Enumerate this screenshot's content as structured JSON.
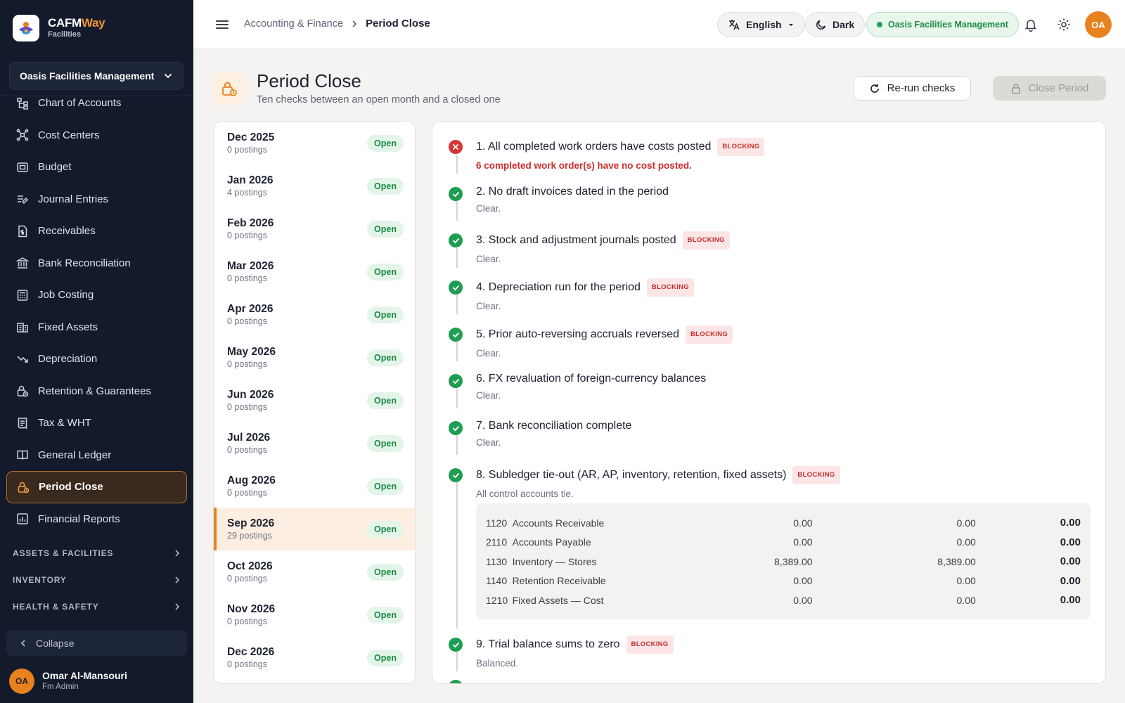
{
  "brand": {
    "name_main": "CAFM",
    "name_accent": "Way",
    "sub": "Facilities"
  },
  "org_select": {
    "value": "Oasis Facilities Management"
  },
  "sidebar": {
    "items": [
      {
        "label": "Chart of Accounts",
        "icon": "hierarchy-icon",
        "active": false
      },
      {
        "label": "Cost Centers",
        "icon": "network-icon",
        "active": false
      },
      {
        "label": "Budget",
        "icon": "wallet-icon",
        "active": false
      },
      {
        "label": "Journal Entries",
        "icon": "edit-lines-icon",
        "active": false
      },
      {
        "label": "Receivables",
        "icon": "dollar-doc-icon",
        "active": false
      },
      {
        "label": "Bank Reconciliation",
        "icon": "bank-icon",
        "active": false
      },
      {
        "label": "Job Costing",
        "icon": "calculator-icon",
        "active": false
      },
      {
        "label": "Fixed Assets",
        "icon": "building-icon",
        "active": false
      },
      {
        "label": "Depreciation",
        "icon": "trend-down-icon",
        "active": false
      },
      {
        "label": "Retention & Guarantees",
        "icon": "lock-clock-icon",
        "active": false
      },
      {
        "label": "Tax & WHT",
        "icon": "receipt-icon",
        "active": false
      },
      {
        "label": "General Ledger",
        "icon": "book-icon",
        "active": false
      },
      {
        "label": "Period Close",
        "icon": "lock-clock-icon",
        "active": true
      },
      {
        "label": "Financial Reports",
        "icon": "bar-chart-icon",
        "active": false
      }
    ],
    "sections": [
      "ASSETS & FACILITIES",
      "INVENTORY",
      "HEALTH & SAFETY"
    ],
    "collapse_label": "Collapse",
    "user": {
      "initials": "OA",
      "name": "Omar Al-Mansouri",
      "role": "Fm Admin"
    }
  },
  "topbar": {
    "breadcrumb": [
      "Accounting & Finance",
      "Period Close"
    ],
    "language": "English",
    "theme": "Dark",
    "org_badge": "Oasis Facilities Management",
    "avatar_initials": "OA"
  },
  "page": {
    "title": "Period Close",
    "subtitle": "Ten checks between an open month and a closed one",
    "rerun_label": "Re-run checks",
    "close_label": "Close Period"
  },
  "periods": [
    {
      "name": "Dec 2025",
      "count": "0 postings",
      "status": "Open",
      "selected": false
    },
    {
      "name": "Jan 2026",
      "count": "4 postings",
      "status": "Open",
      "selected": false
    },
    {
      "name": "Feb 2026",
      "count": "0 postings",
      "status": "Open",
      "selected": false
    },
    {
      "name": "Mar 2026",
      "count": "0 postings",
      "status": "Open",
      "selected": false
    },
    {
      "name": "Apr 2026",
      "count": "0 postings",
      "status": "Open",
      "selected": false
    },
    {
      "name": "May 2026",
      "count": "0 postings",
      "status": "Open",
      "selected": false
    },
    {
      "name": "Jun 2026",
      "count": "0 postings",
      "status": "Open",
      "selected": false
    },
    {
      "name": "Jul 2026",
      "count": "0 postings",
      "status": "Open",
      "selected": false
    },
    {
      "name": "Aug 2026",
      "count": "0 postings",
      "status": "Open",
      "selected": false
    },
    {
      "name": "Sep 2026",
      "count": "29 postings",
      "status": "Open",
      "selected": true
    },
    {
      "name": "Oct 2026",
      "count": "0 postings",
      "status": "Open",
      "selected": false
    },
    {
      "name": "Nov 2026",
      "count": "0 postings",
      "status": "Open",
      "selected": false
    },
    {
      "name": "Dec 2026",
      "count": "0 postings",
      "status": "Open",
      "selected": false
    }
  ],
  "blocking_label": "BLOCKING",
  "checks": [
    {
      "title": "1. All completed work orders have costs posted",
      "blocking": true,
      "status": "fail",
      "note": "6 completed work order(s) have no cost posted."
    },
    {
      "title": "2. No draft invoices dated in the period",
      "blocking": false,
      "status": "ok",
      "note": "Clear."
    },
    {
      "title": "3. Stock and adjustment journals posted",
      "blocking": true,
      "status": "ok",
      "note": "Clear."
    },
    {
      "title": "4. Depreciation run for the period",
      "blocking": true,
      "status": "ok",
      "note": "Clear."
    },
    {
      "title": "5. Prior auto-reversing accruals reversed",
      "blocking": true,
      "status": "ok",
      "note": "Clear."
    },
    {
      "title": "6. FX revaluation of foreign-currency balances",
      "blocking": false,
      "status": "ok",
      "note": "Clear."
    },
    {
      "title": "7. Bank reconciliation complete",
      "blocking": false,
      "status": "ok",
      "note": "Clear."
    },
    {
      "title": "8. Subledger tie-out (AR, AP, inventory, retention, fixed assets)",
      "blocking": true,
      "status": "ok",
      "note": "All control accounts tie."
    },
    {
      "title": "9. Trial balance sums to zero",
      "blocking": true,
      "status": "ok",
      "note": "Balanced."
    }
  ],
  "tieout": [
    {
      "code": "1120",
      "name": "Accounts Receivable",
      "v1": "0.00",
      "v2": "0.00",
      "v3": "0.00"
    },
    {
      "code": "2110",
      "name": "Accounts Payable",
      "v1": "0.00",
      "v2": "0.00",
      "v3": "0.00"
    },
    {
      "code": "1130",
      "name": "Inventory — Stores",
      "v1": "8,389.00",
      "v2": "8,389.00",
      "v3": "0.00"
    },
    {
      "code": "1140",
      "name": "Retention Receivable",
      "v1": "0.00",
      "v2": "0.00",
      "v3": "0.00"
    },
    {
      "code": "1210",
      "name": "Fixed Assets — Cost",
      "v1": "0.00",
      "v2": "0.00",
      "v3": "0.00"
    }
  ],
  "colors": {
    "accent": "#e8821f",
    "sidebar_bg": "#131a2c",
    "success": "#1f9d53",
    "danger": "#d93434"
  }
}
